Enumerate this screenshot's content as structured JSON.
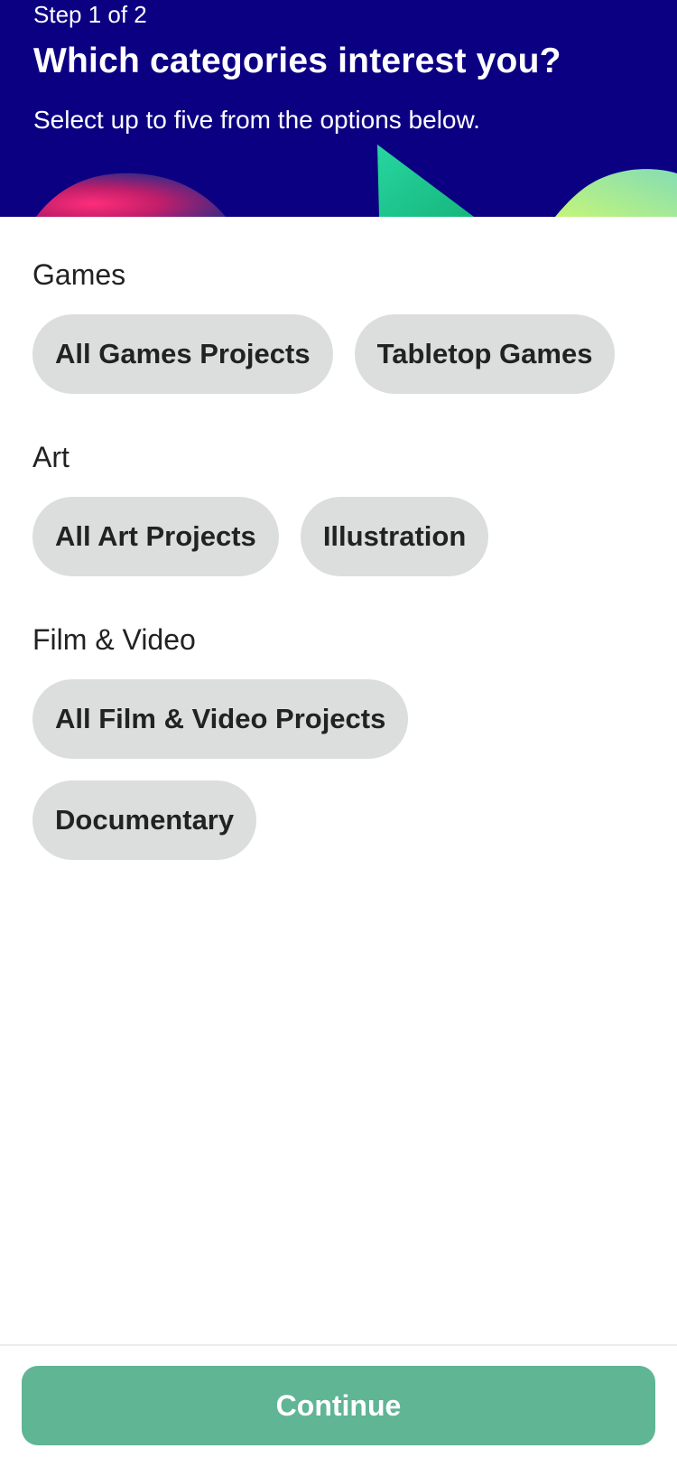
{
  "header": {
    "step": "Step 1 of 2",
    "title": "Which categories interest you?",
    "subtitle": "Select up to five from the options below."
  },
  "sections": [
    {
      "title": "Games",
      "chips": [
        "All Games Projects",
        "Tabletop Games"
      ]
    },
    {
      "title": "Art",
      "chips": [
        "All Art Projects",
        "Illustration"
      ]
    },
    {
      "title": "Film & Video",
      "chips": [
        "All Film & Video Projects",
        "Documentary"
      ]
    }
  ],
  "footer": {
    "continue_label": "Continue"
  },
  "colors": {
    "header_bg": "#0c0082",
    "chip_bg": "#dcdddd",
    "continue_bg": "#5fb594"
  }
}
